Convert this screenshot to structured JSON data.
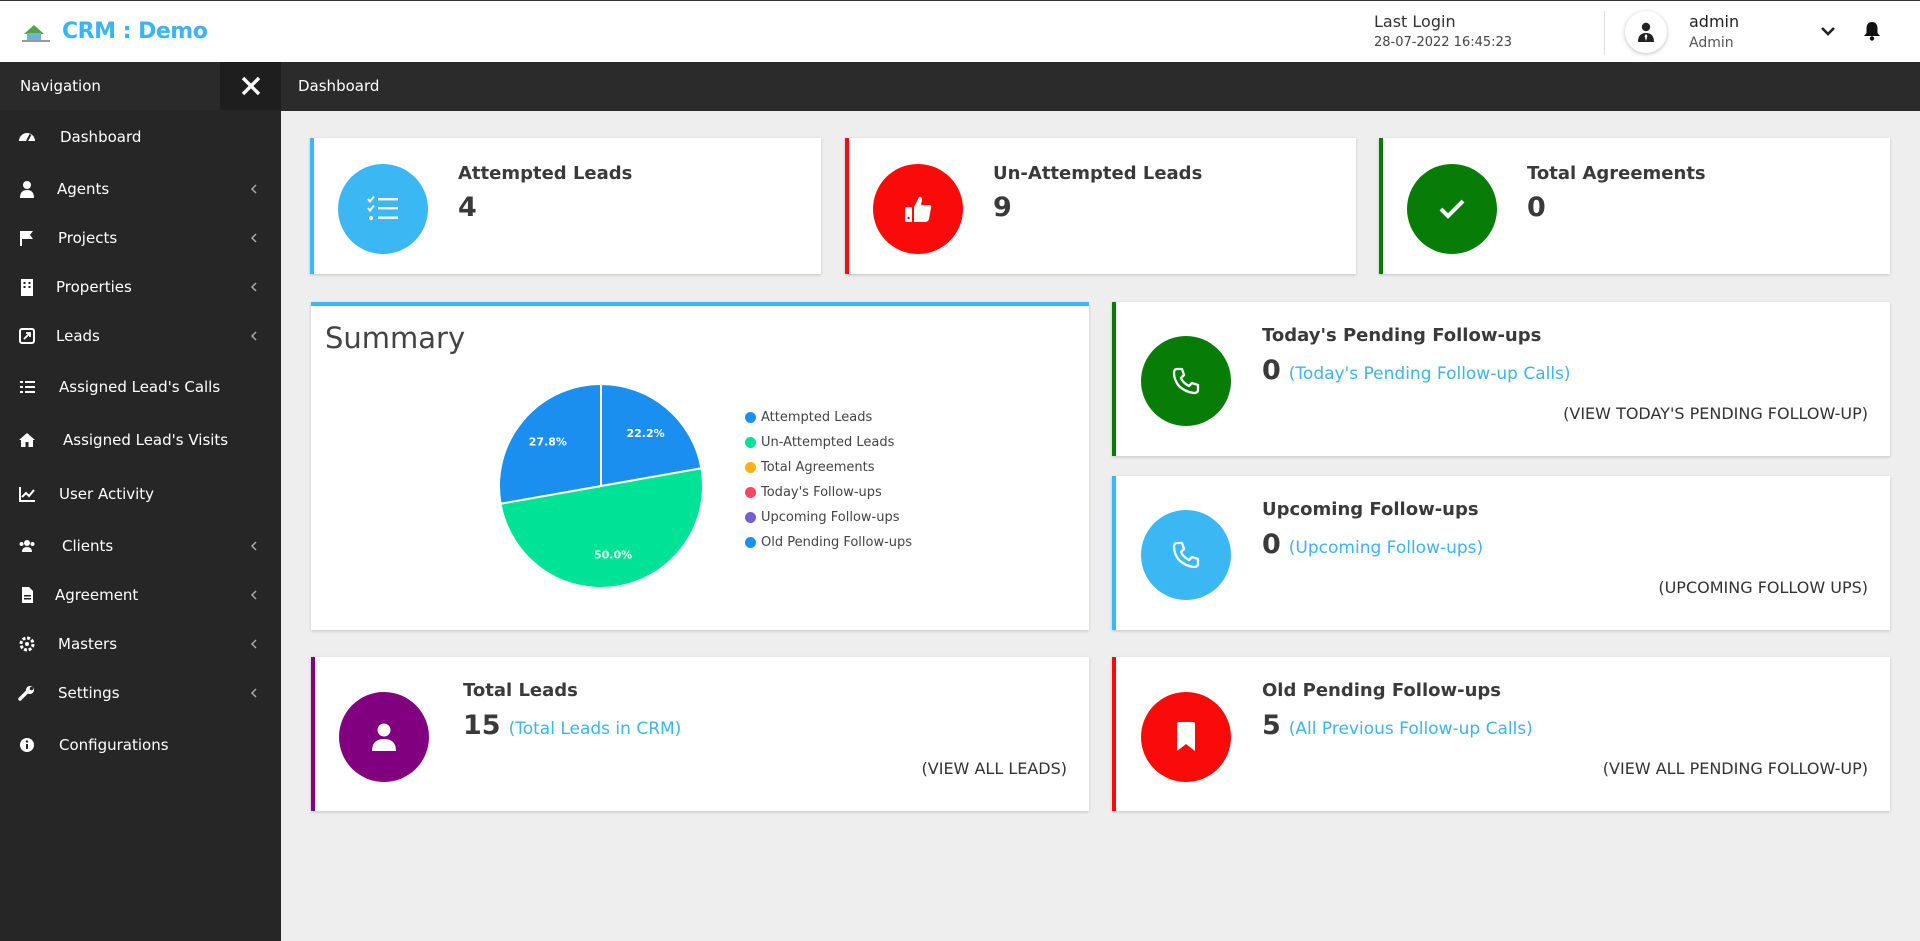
{
  "header": {
    "app_title": "CRM : Demo",
    "last_login_label": "Last Login",
    "last_login_value": "28-07-2022 16:45:23",
    "user_name": "admin",
    "user_role": "Admin"
  },
  "sidebar": {
    "title": "Navigation",
    "items": [
      {
        "label": "Dashboard",
        "icon": "speedometer-icon",
        "has_arrow": false
      },
      {
        "label": "Agents",
        "icon": "agent-icon",
        "has_arrow": true
      },
      {
        "label": "Projects",
        "icon": "flag-icon",
        "has_arrow": true
      },
      {
        "label": "Properties",
        "icon": "building-icon",
        "has_arrow": true
      },
      {
        "label": "Leads",
        "icon": "leads-icon",
        "has_arrow": true
      },
      {
        "label": "Assigned Lead's Calls",
        "icon": "list-check-icon",
        "has_arrow": false
      },
      {
        "label": "Assigned Lead's Visits",
        "icon": "house-icon",
        "has_arrow": false
      },
      {
        "label": "User Activity",
        "icon": "line-chart-icon",
        "has_arrow": false
      },
      {
        "label": "Clients",
        "icon": "users-icon",
        "has_arrow": true
      },
      {
        "label": "Agreement",
        "icon": "file-icon",
        "has_arrow": true
      },
      {
        "label": "Masters",
        "icon": "cog-icon",
        "has_arrow": true
      },
      {
        "label": "Settings",
        "icon": "wrench-icon",
        "has_arrow": true
      },
      {
        "label": "Configurations",
        "icon": "info-icon",
        "has_arrow": false
      }
    ]
  },
  "breadcrumb": "Dashboard",
  "stats": [
    {
      "label": "Attempted Leads",
      "value": "4",
      "color": "#3bb8f4",
      "icon": "checklist-icon"
    },
    {
      "label": "Un-Attempted Leads",
      "value": "9",
      "color": "#fb0a0a",
      "icon": "thumbs-up-icon"
    },
    {
      "label": "Total Agreements",
      "value": "0",
      "color": "#077d07",
      "icon": "check-icon"
    }
  ],
  "summary": {
    "title": "Summary"
  },
  "followups": [
    {
      "label": "Today's Pending Follow-ups",
      "value": "0",
      "link": "(Today's Pending Follow-up Calls)",
      "view": "(VIEW TODAY'S PENDING FOLLOW-UP)",
      "color": "#077d07",
      "icon": "phone-icon"
    },
    {
      "label": "Upcoming Follow-ups",
      "value": "0",
      "link": "(Upcoming Follow-ups)",
      "view": "(UPCOMING FOLLOW UPS)",
      "color": "#3bb8f4",
      "icon": "phone-icon"
    },
    {
      "label": "Total Leads",
      "value": "15",
      "link": "(Total Leads in CRM)",
      "view": "(VIEW ALL LEADS)",
      "color": "#800080",
      "icon": "user-icon"
    },
    {
      "label": "Old Pending Follow-ups",
      "value": "5",
      "link": "(All Previous Follow-up Calls)",
      "view": "(VIEW ALL PENDING FOLLOW-UP)",
      "color": "#fb0a0a",
      "icon": "bookmark-icon"
    }
  ],
  "chart_data": {
    "type": "pie",
    "title": "Summary",
    "legend_position": "right",
    "series": [
      {
        "name": "Attempted Leads",
        "value": 4,
        "color": "#1b8ff0",
        "label": "22.2%"
      },
      {
        "name": "Un-Attempted Leads",
        "value": 9,
        "color": "#00e396",
        "label": "50.0%"
      },
      {
        "name": "Total Agreements",
        "value": 0,
        "color": "#feb019",
        "label": ""
      },
      {
        "name": "Today's Follow-ups",
        "value": 0,
        "color": "#ff4560",
        "label": ""
      },
      {
        "name": "Upcoming Follow-ups",
        "value": 0,
        "color": "#775dd0",
        "label": ""
      },
      {
        "name": "Old Pending Follow-ups",
        "value": 5,
        "color": "#1b8ff0",
        "label": "27.8%"
      }
    ]
  }
}
